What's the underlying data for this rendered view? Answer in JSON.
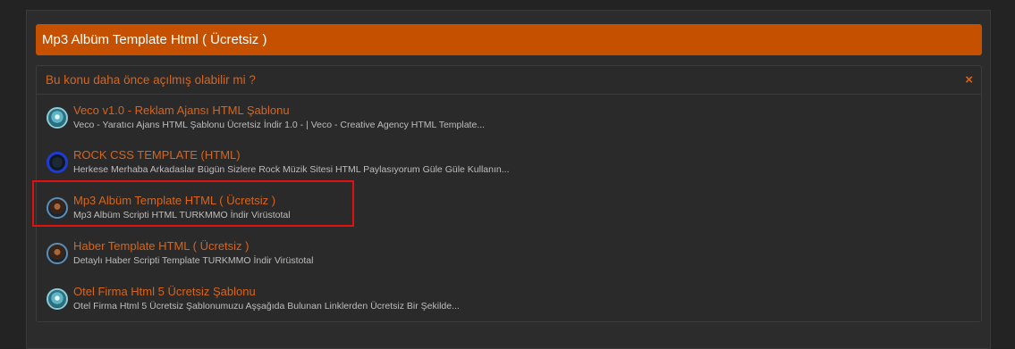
{
  "thread": {
    "title": "Mp3 Albüm Template Html ( Ücretsiz )"
  },
  "similar": {
    "header": "Bu konu daha önce açılmış olabilir mi ?",
    "close_label": "×",
    "items": [
      {
        "title": "Veco v1.0 - Reklam Ajansı HTML Şablonu",
        "desc": "Veco - Yaratıcı Ajans HTML Şablonu Ücretsiz İndir 1.0 - | Veco - Creative Agency HTML Template..."
      },
      {
        "title": "ROCK CSS TEMPLATE (HTML)",
        "desc": "Herkese Merhaba Arkadaslar Bügün Sizlere Rock Müzik Sitesi HTML Paylasıyorum Güle Güle Kullanın..."
      },
      {
        "title": "Mp3 Albüm Template HTML ( Ücretsiz )",
        "desc": "Mp3 Albüm Scripti HTML TURKMMO İndir Virüstotal"
      },
      {
        "title": "Haber Template HTML ( Ücretsiz )",
        "desc": "Detaylı Haber Scripti Template TURKMMO İndir Virüstotal"
      },
      {
        "title": "Otel Firma Html 5 Ücretsiz Şablonu",
        "desc": "Otel Firma Html 5 Ücretsiz Şablonumuzu Aşşağıda Bulunan Linklerden Ücretsiz Bir Şekilde..."
      }
    ]
  },
  "colors": {
    "accent": "#c55000",
    "link": "#d9641a",
    "highlight_border": "#e01010"
  }
}
